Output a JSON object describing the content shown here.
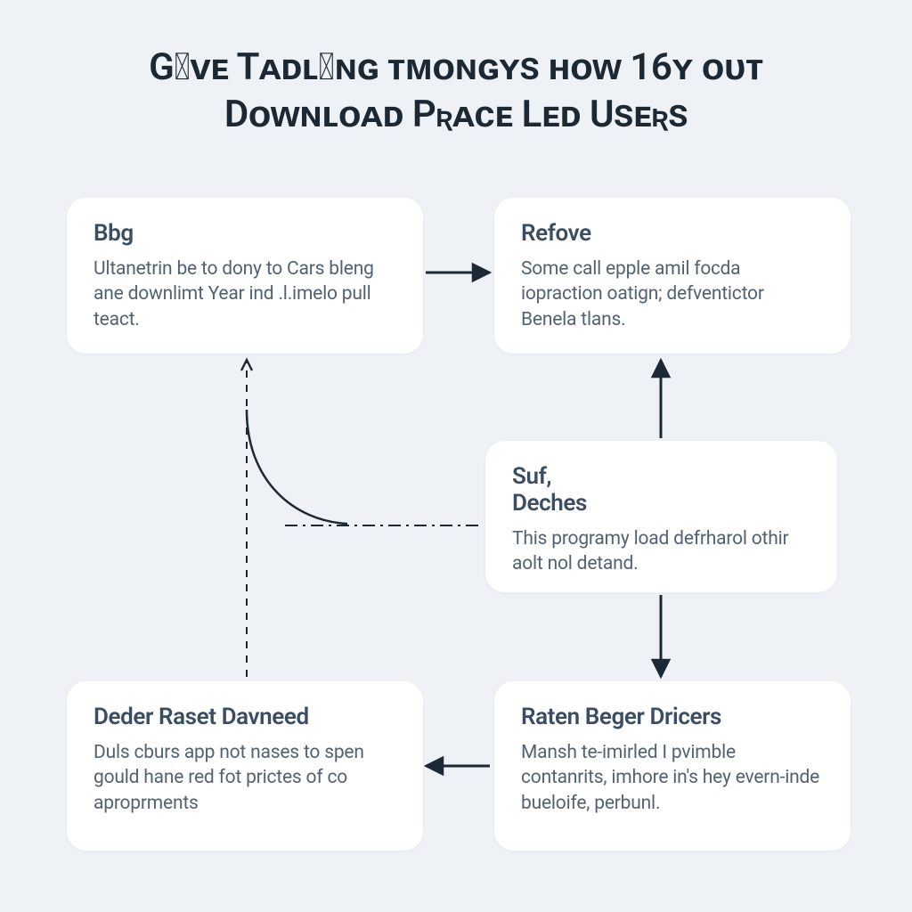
{
  "title_line1": "Gɪᴠᴇ Tᴀᴅʟɪɴɢ ᴛᴍᴏɴɢʏs ʜᴏᴡ 16ʏ ᴏᴜᴛ",
  "title_line2": "Dᴏᴡɴʟᴏᴀᴅ Pʀᴀᴄᴇ Lᴇᴅ Usᴇʀs",
  "cards": {
    "bbg": {
      "title": "Bbg",
      "body": "Ultanetrin be to dony to Cars bleng ane downlimt Year ind .l.imelo pull teact."
    },
    "refove": {
      "title": "Refove",
      "body": "Some call epple amil foᴄda iopraction oatign; defventictor Benela tlans."
    },
    "suf": {
      "title": "Suf,\nDeches",
      "body": "This programy load defrharol othir aolt nol detand."
    },
    "deder": {
      "title": "Deder Raset Davneed",
      "body": "Duls cburs app not nases to spen gould hane red fot prictes of co aproprments"
    },
    "raten": {
      "title": "Raten Beger Dricers",
      "body": "Mansh te-imirled I pvimble contanrits, imhore in's hey evern-inde bueloife, perbunl."
    }
  }
}
